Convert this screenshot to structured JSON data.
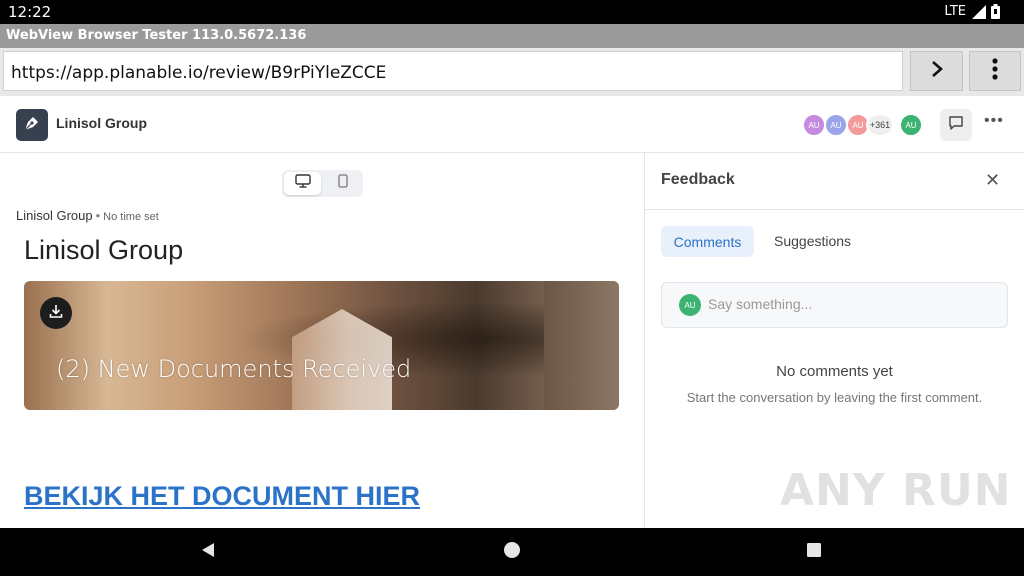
{
  "status_bar": {
    "time": "12:22",
    "network": "LTE"
  },
  "window": {
    "title": "WebView Browser Tester 113.0.5672.136"
  },
  "address_bar": {
    "url": "https://app.planable.io/review/B9rPiYleZCCE"
  },
  "app_header": {
    "workspace_name": "Linisol Group",
    "avatars": [
      {
        "initials": "AU",
        "color": "#c58be0"
      },
      {
        "initials": "AU",
        "color": "#9aa4e8"
      },
      {
        "initials": "AU",
        "color": "#f49a9a"
      }
    ],
    "more_count": "+361",
    "current_user_initials": "AU",
    "current_user_color": "#3cb371"
  },
  "post": {
    "author": "Linisol Group",
    "schedule": "No time set",
    "title": "Linisol Group",
    "image_caption": "(2) New Documents Received",
    "link_text": "BEKIJK HET DOCUMENT HIER",
    "link_color": "#2a73c9"
  },
  "feedback": {
    "title": "Feedback",
    "tabs": [
      {
        "label": "Comments",
        "active": true
      },
      {
        "label": "Suggestions",
        "active": false
      }
    ],
    "input_placeholder": "Say something...",
    "input_avatar_initials": "AU",
    "empty_title": "No comments yet",
    "empty_subtitle": "Start the conversation by leaving the first comment."
  },
  "watermark": "ANY RUN"
}
